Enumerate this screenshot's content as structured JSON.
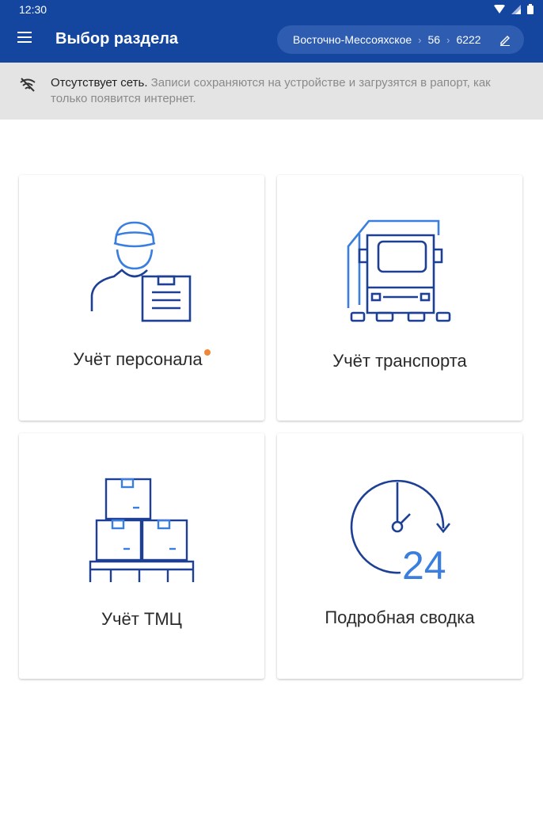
{
  "status_bar": {
    "time": "12:30"
  },
  "app_bar": {
    "title": "Выбор раздела",
    "breadcrumb": {
      "field": "Восточно-Мессояхское",
      "pad": "56",
      "well": "6222"
    }
  },
  "offline_banner": {
    "bold_text": "Отсутствует сеть.",
    "text": " Записи сохраняются на устройстве и загрузятся в рапорт, как только появится интернет."
  },
  "cards": [
    {
      "label": "Учёт персонала",
      "icon": "worker-clipboard-icon",
      "has_notification": true
    },
    {
      "label": "Учёт транспорта",
      "icon": "truck-icon",
      "has_notification": false
    },
    {
      "label": "Учёт ТМЦ",
      "icon": "boxes-pallet-icon",
      "has_notification": false
    },
    {
      "label": "Подробная сводка",
      "icon": "clock-24-icon",
      "has_notification": false
    }
  ],
  "colors": {
    "primary": "#1446a0",
    "icon_dark": "#1d3f94",
    "icon_light": "#3a7fe0",
    "notification": "#f0883a"
  }
}
